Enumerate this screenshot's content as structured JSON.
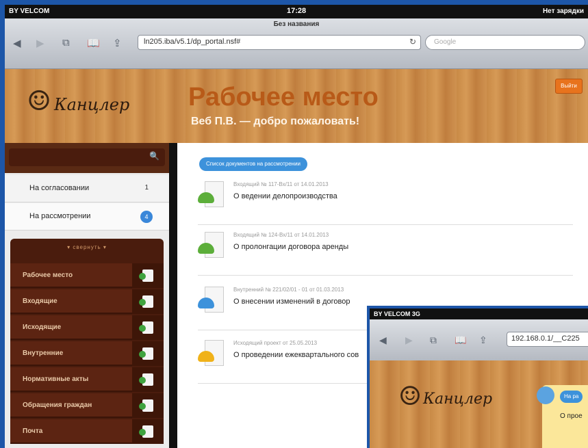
{
  "statusbar": {
    "carrier": "BY VELCOM",
    "time": "17:28",
    "battery": "Нет зарядки"
  },
  "browser": {
    "page_title": "Без названия",
    "url": "ln205.iba/v5.1/dp_portal.nsf#",
    "search_placeholder": "Google"
  },
  "header": {
    "logo_text": "Канцлер",
    "title": "Рабочее место",
    "subtitle": "Веб П.В. — добро пожаловать!",
    "exit_label": "Выйти"
  },
  "sidebar": {
    "rows": [
      {
        "label": "На согласовании",
        "count": "1"
      },
      {
        "label": "На рассмотрении",
        "count": "4"
      }
    ],
    "collapse_label": "свернуть",
    "menu": [
      {
        "label": "Рабочее место"
      },
      {
        "label": "Входящие"
      },
      {
        "label": "Исходящие"
      },
      {
        "label": "Внутренние"
      },
      {
        "label": "Нормативные акты"
      },
      {
        "label": "Обращения граждан"
      },
      {
        "label": "Почта"
      }
    ]
  },
  "content": {
    "list_button": "Список документов на рассмотрении",
    "documents": [
      {
        "meta": "Входящий № 117-Вх/11 от 14.01.2013",
        "title": "О ведении делопроизводства",
        "arrow_color": "#5cae3a"
      },
      {
        "meta": "Входящий № 124-Вх/11 от 14.01.2013",
        "title": "О пролонгации договора аренды",
        "arrow_color": "#5cae3a"
      },
      {
        "meta": "Внутренний № 221/02/01 - 01 от 01.03.2013",
        "title": "О внесении изменений в договор",
        "arrow_color": "#3d92db"
      },
      {
        "meta": "Исходящий проект от 25.05.2013",
        "title": "О проведении ежеквартального сов",
        "arrow_color": "#f0b21a"
      }
    ]
  },
  "overlay": {
    "carrier": "BY VELCOM  3G",
    "url": "192.168.0.1/__C225",
    "logo_text": "Канцлер",
    "note_button": "На ра",
    "note_text": "О прое"
  }
}
